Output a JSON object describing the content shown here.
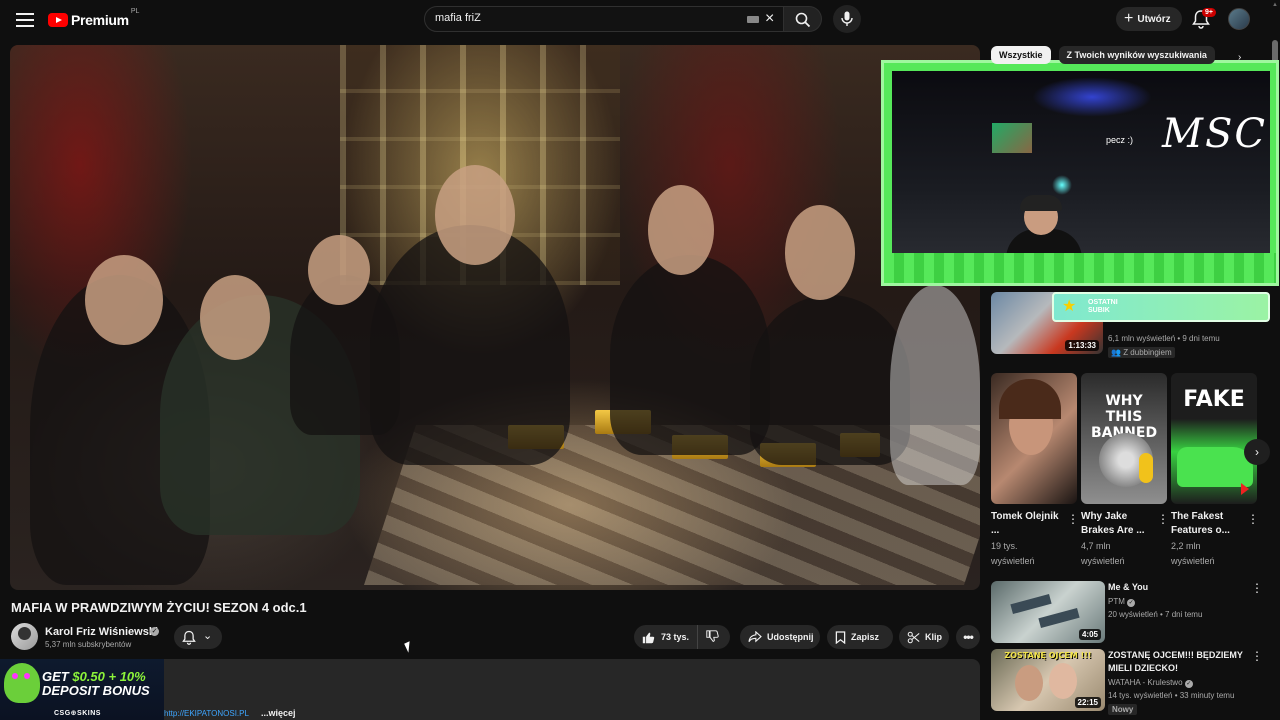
{
  "masthead": {
    "logo_text": "Premium",
    "logo_country": "PL",
    "search_value": "mafia friZ",
    "create_label": "Utwórz",
    "notification_count": "9+"
  },
  "overlay": {
    "stream_text": "MSC",
    "stream_caption": "pecz :)",
    "sub_label_line1": "OSTATNI",
    "sub_label_line2": "SUBIK"
  },
  "video": {
    "title": "MAFIA W PRAWDZIWYM ŻYCIU! SEZON 4 odc.1",
    "channel_name": "Karol Friz Wiśniewski",
    "subscribers": "5,37 mln subskrybentów",
    "likes": "73 tys.",
    "share_label": "Udostępnij",
    "save_label": "Zapisz",
    "clip_label": "Klip",
    "more_label": "•••"
  },
  "description": {
    "ad_line1_a": "GET ",
    "ad_line1_b": "$0.50 + 10%",
    "ad_line2": "DEPOSIT BONUS",
    "ad_brand": "CSG⊕SKINS",
    "link_text": "http://EKIPATONOSI.PL",
    "more_label": "...więcej"
  },
  "sidebar": {
    "chips": [
      {
        "label": "Wszystkie",
        "active": true
      },
      {
        "label": "Z Twoich wyników wyszukiwania",
        "active": false
      }
    ],
    "first_rec": {
      "duration": "1:13:33",
      "meta": "6,1 mln wyświetleń • 9 dni temu",
      "dub_label": "Z dubbingiem"
    },
    "shelf": [
      {
        "thumb_text": "",
        "title": "Tomek Olejnik ...",
        "views_line1": "19 tys.",
        "views_line2": "wyświetleń",
        "thumb_colors": [
          "#3a2a22",
          "#b78870"
        ]
      },
      {
        "thumb_text": "WHY THIS BANNED",
        "title": "Why Jake Brakes Are ...",
        "views_line1": "4,7 mln",
        "views_line2": "wyświetleń",
        "thumb_colors": [
          "#2b2b2b",
          "#8f8f8f"
        ]
      },
      {
        "thumb_text": "FAKE",
        "title": "The Fakest Features o...",
        "views_line1": "2,2 mln",
        "views_line2": "wyświetleń",
        "thumb_colors": [
          "#1d1d1d",
          "#38d141"
        ]
      }
    ],
    "recs": [
      {
        "title": "Me & You",
        "channel": "PTM",
        "meta": "20 wyświetleń • 7 dni temu",
        "duration": "4:05",
        "thumb_colors": [
          "#5a6a6a",
          "#c9d2cf"
        ],
        "thumb_text": "",
        "new": ""
      },
      {
        "title": "ZOSTANĘ OJCEM!!! BĘDZIEMY MIELI DZIECKO!",
        "channel": "WATAHA - Krulestwo",
        "meta": "14 tys. wyświetleń • 33 minuty temu",
        "duration": "22:15",
        "thumb_colors": [
          "#6a6a55",
          "#d7c7b0"
        ],
        "thumb_text": "ZOSTANĘ OJCEM !!!",
        "new": "Nowy"
      }
    ]
  }
}
